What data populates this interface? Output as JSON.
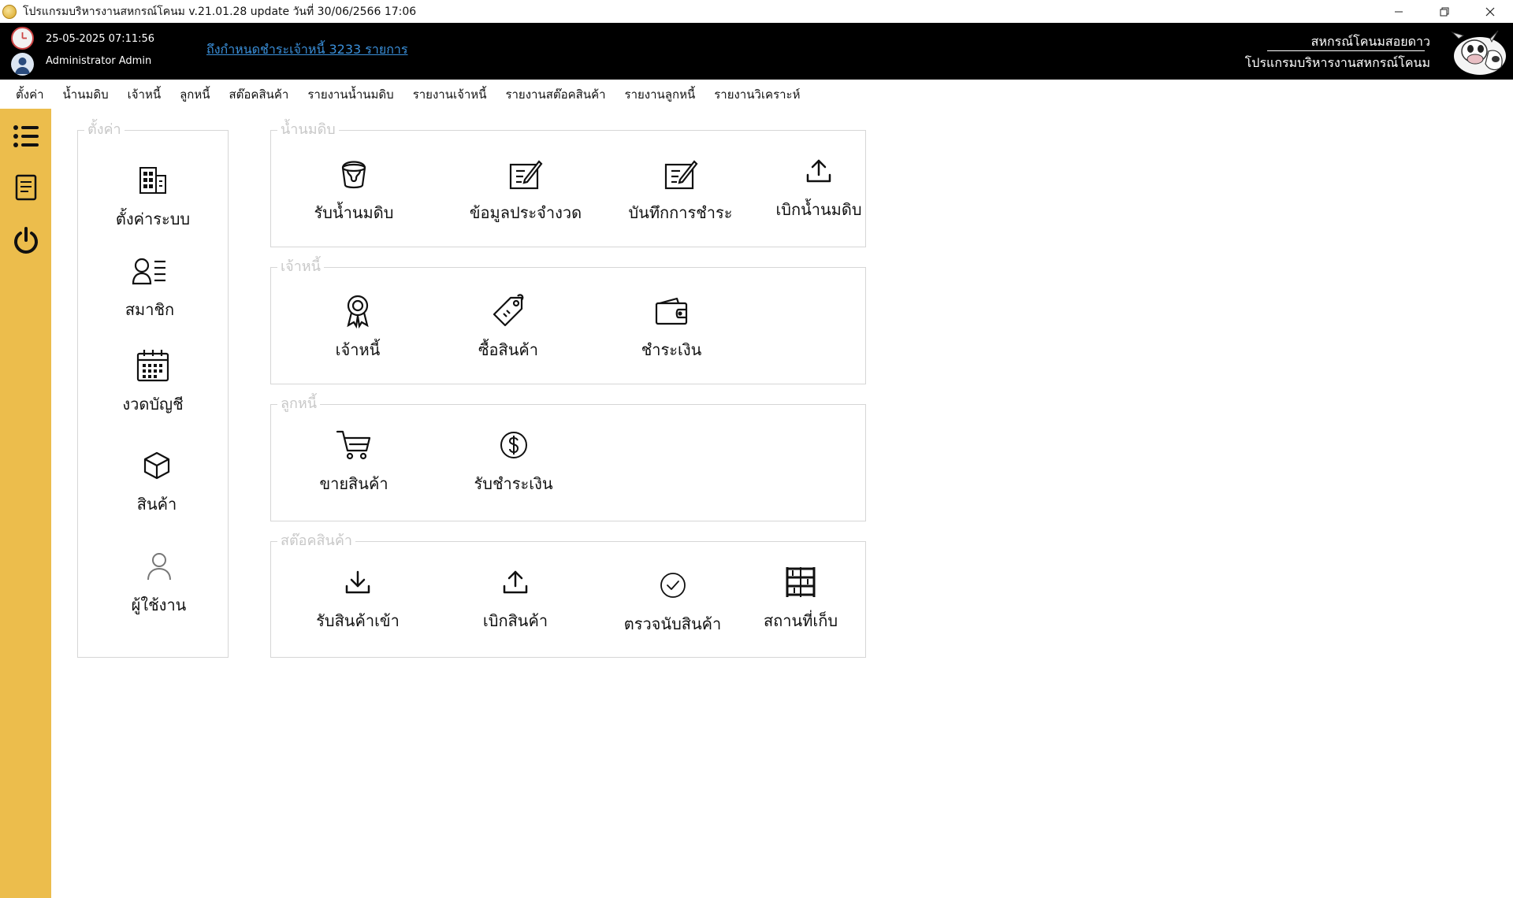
{
  "window": {
    "title": "โปรแกรมบริหารงานสหกรณ์โคนม v.21.01.28 update วันที่ 30/06/2566 17:06",
    "icons": [
      "app-icon",
      "minimize-icon",
      "restore-icon",
      "close-icon"
    ]
  },
  "header": {
    "datetime": "25-05-2025 07:11:56",
    "user": "Administrator Admin",
    "alert": "ถึงกำหนดชำระเจ้าหนี้ 3233 รายการ",
    "coop_name": "สหกรณ์โคนมสอยดาว",
    "program_name": "โปรแกรมบริหารงานสหกรณ์โคนม",
    "colors": {
      "background": "#000000",
      "alert_link": "#3a8fd9"
    }
  },
  "menu": {
    "items": [
      "ตั้งค่า",
      "น้ำนมดิบ",
      "เจ้าหนี้",
      "ลูกหนี้",
      "สต๊อคสินค้า",
      "รายงานน้ำนมดิบ",
      "รายงานเจ้าหนี้",
      "รายงานสต๊อคสินค้า",
      "รายงานลูกหนี้",
      "รายงานวิเคราะห์"
    ]
  },
  "sidebar": {
    "color": "#ecbd4c",
    "icons": [
      "list-icon",
      "document-icon",
      "power-icon"
    ]
  },
  "groups": {
    "settings": {
      "legend": "ตั้งค่า",
      "tiles": [
        {
          "label": "ตั้งค่าระบบ",
          "icon": "building-icon"
        },
        {
          "label": "สมาชิก",
          "icon": "member-list-icon"
        },
        {
          "label": "งวดบัญชี",
          "icon": "calendar-icon"
        },
        {
          "label": "สินค้า",
          "icon": "box-icon"
        },
        {
          "label": "ผู้ใช้งาน",
          "icon": "user-icon"
        }
      ]
    },
    "raw_milk": {
      "legend": "น้ำนมดิบ",
      "tiles": [
        {
          "label": "รับน้ำนมดิบ",
          "icon": "milk-bucket-icon"
        },
        {
          "label": "ข้อมูลประจำงวด",
          "icon": "edit-icon"
        },
        {
          "label": "บันทึกการชำระ",
          "icon": "edit-icon"
        },
        {
          "label": "เบิกน้ำนมดิบ",
          "icon": "upload-icon"
        }
      ]
    },
    "creditors": {
      "legend": "เจ้าหนี้",
      "tiles": [
        {
          "label": "เจ้าหนี้",
          "icon": "badge-icon"
        },
        {
          "label": "ซื้อสินค้า",
          "icon": "price-tag-icon"
        },
        {
          "label": "ชำระเงิน",
          "icon": "wallet-icon"
        }
      ]
    },
    "debtors": {
      "legend": "ลูกหนี้",
      "tiles": [
        {
          "label": "ขายสินค้า",
          "icon": "cart-icon"
        },
        {
          "label": "รับชำระเงิน",
          "icon": "dollar-coin-icon"
        }
      ]
    },
    "stock": {
      "legend": "สต๊อคสินค้า",
      "tiles": [
        {
          "label": "รับสินค้าเข้า",
          "icon": "download-icon"
        },
        {
          "label": "เบิกสินค้า",
          "icon": "upload-icon"
        },
        {
          "label": "ตรวจนับสินค้า",
          "icon": "check-circle-icon"
        },
        {
          "label": "สถานที่เก็บ",
          "icon": "shelf-icon"
        }
      ]
    }
  }
}
